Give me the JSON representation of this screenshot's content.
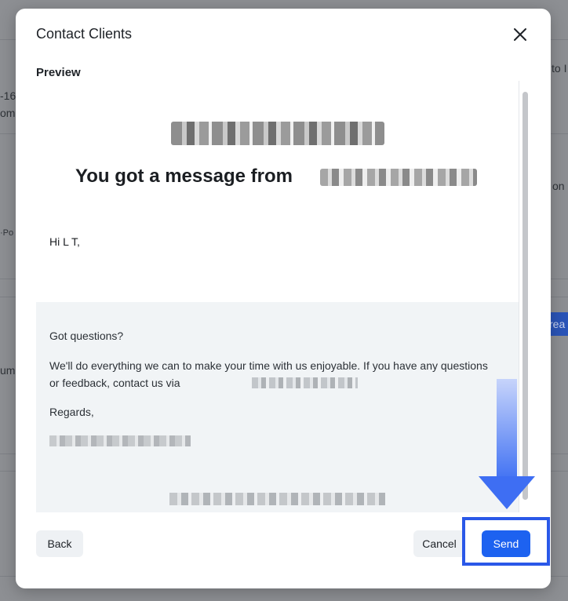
{
  "background": {
    "fragments": [
      "to I",
      "-16",
      "om",
      "on",
      "·Po",
      "rea",
      "um"
    ]
  },
  "modal": {
    "title": "Contact Clients",
    "preview_label": "Preview",
    "email": {
      "headline": "You got a message from",
      "greeting": "Hi L T,",
      "questions": "Got questions?",
      "body": "We'll do everything we can to make your time with us enjoyable. If you have any questions or feedback, contact us via",
      "regards": "Regards,"
    },
    "buttons": {
      "back": "Back",
      "cancel": "Cancel",
      "send": "Send"
    }
  },
  "icons": {
    "close": "close-icon",
    "annotation": "arrow-down-icon"
  },
  "colors": {
    "primary": "#1d62f0",
    "annotation": "#2a58e8"
  }
}
